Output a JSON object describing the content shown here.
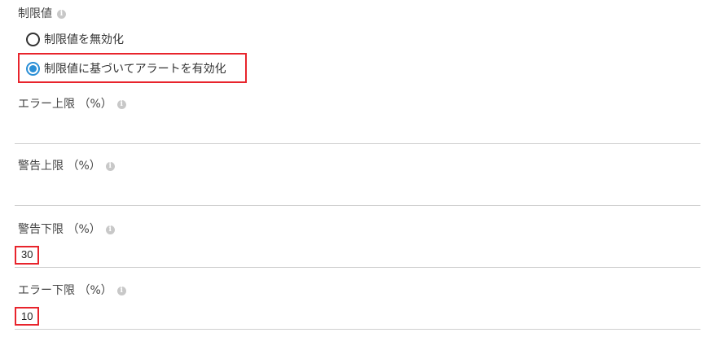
{
  "limit_section": {
    "label": "制限値",
    "info_icon": "info-icon",
    "options": [
      {
        "label": "制限値を無効化",
        "selected": false
      },
      {
        "label": "制限値に基づいてアラートを有効化",
        "selected": true
      }
    ]
  },
  "fields": [
    {
      "label": "エラー上限 （%）",
      "value": ""
    },
    {
      "label": "警告上限 （%）",
      "value": ""
    },
    {
      "label": "警告下限 （%）",
      "value": "30"
    },
    {
      "label": "エラー下限 （%）",
      "value": "10"
    }
  ],
  "colors": {
    "highlight": "#e8242c",
    "radio_selected": "#2a8fd6",
    "divider": "#cfcfcf"
  }
}
